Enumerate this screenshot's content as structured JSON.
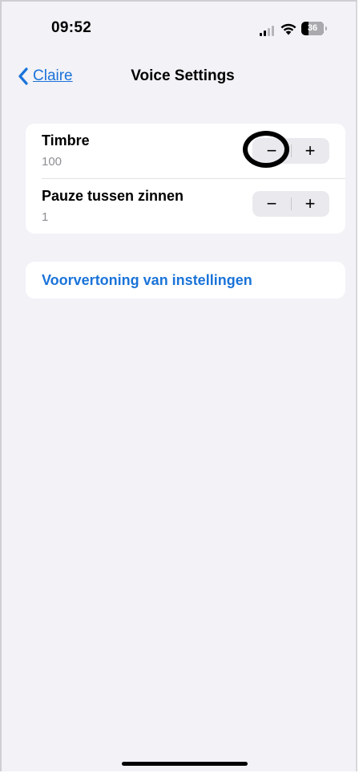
{
  "status_bar": {
    "time": "09:52",
    "battery_level": "36",
    "signal_icon": "cellular-signal-icon",
    "wifi_icon": "wifi-icon",
    "battery_icon": "battery-icon"
  },
  "nav": {
    "back_label": "Claire",
    "back_icon": "chevron-left-icon",
    "title": "Voice Settings"
  },
  "settings": [
    {
      "label": "Timbre",
      "value": "100",
      "minus": "−",
      "plus": "+"
    },
    {
      "label": "Pauze tussen zinnen",
      "value": "1",
      "minus": "−",
      "plus": "+"
    }
  ],
  "preview": {
    "label": "Voorvertoning van instellingen"
  },
  "colors": {
    "accent": "#1a73d9",
    "background": "#f2f2f7",
    "card": "#ffffff",
    "secondary_text": "#8e8e93"
  }
}
